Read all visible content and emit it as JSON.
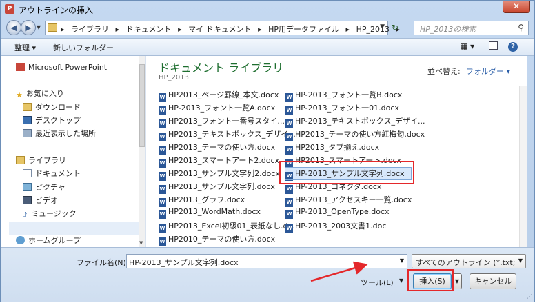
{
  "window": {
    "title": "アウトラインの挿入",
    "app_icon": "P",
    "close": "✕"
  },
  "address": {
    "breadcrumbs": [
      "ライブラリ",
      "ドキュメント",
      "マイ ドキュメント",
      "HP用データファイル",
      "HP_2013"
    ],
    "search_placeholder": "HP_2013の検索"
  },
  "toolbar": {
    "organize": "整理 ▾",
    "new_folder": "新しいフォルダー"
  },
  "sidebar": {
    "powerpoint": "Microsoft PowerPoint",
    "favorites": "お気に入り",
    "downloads": "ダウンロード",
    "desktop": "デスクトップ",
    "recent": "最近表示した場所",
    "libraries": "ライブラリ",
    "documents": "ドキュメント",
    "pictures": "ピクチャ",
    "videos": "ビデオ",
    "music": "ミュージック",
    "homegroup": "ホームグループ"
  },
  "main": {
    "library_title": "ドキュメント ライブラリ",
    "library_sub": "HP_2013",
    "arrange_label": "並べ替え:",
    "arrange_value": "フォルダー ▾",
    "files_col1": [
      "HP2013_ページ罫線_本文.docx",
      "HP-2013_フォント一覧A.docx",
      "HP2013_フォント一番号スタイ...",
      "HP2013_テキストボックス_デザイ...",
      "HP2013_テーマの使い方.docx",
      "HP2013_スマートアート2.docx",
      "HP2013_サンプル文字列2.docx",
      "HP2013_サンプル文字列.docx",
      "HP2013_グラフ.docx",
      "HP2013_WordMath.docx",
      "HP2013_Excel初級01_表紙なし.d...",
      "HP2010_テーマの使い方.docx"
    ],
    "files_col2": [
      "HP-2013_フォント一覧B.docx",
      "HP-2013_フォント一01.docx",
      "HP-2013_テキストボックス_デザイ...",
      "HP2013_テーマの使い方紅梅匂.docx",
      "HP2013_タブ揃え.docx",
      "HP2013_スマートアート.docx",
      "HP-2013_サンプル文字列.docx",
      "HP-2013_コネクタ.docx",
      "HP-2013_アクセスキー一覧.docx",
      "HP-2013_OpenType.docx",
      "HP-2013_2003文書1.doc"
    ]
  },
  "bottom": {
    "filename_label": "ファイル名(N):",
    "filename_value": "HP-2013_サンプル文字列.docx",
    "filetype": "すべてのアウトライン (*.txt;",
    "tools": "ツール(L)",
    "insert": "挿入(S)",
    "cancel": "キャンセル"
  },
  "colors": {
    "highlight": "#e4282b",
    "library_title": "#1e6e2f"
  }
}
